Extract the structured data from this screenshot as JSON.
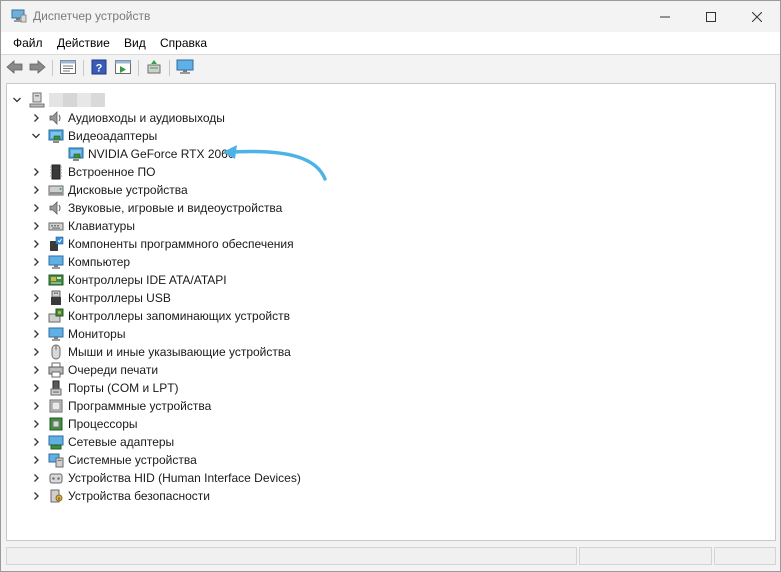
{
  "window": {
    "title": "Диспетчер устройств",
    "controls": [
      "minimize",
      "maximize",
      "close"
    ]
  },
  "menu": {
    "file": "Файл",
    "action": "Действие",
    "view": "Вид",
    "help": "Справка"
  },
  "toolbar": {
    "buttons": [
      "back-icon",
      "forward-icon",
      "properties-icon",
      "help-icon",
      "update-driver-icon",
      "scan-icon",
      "monitor-icon"
    ]
  },
  "tree": {
    "root_icon": "computer-icon",
    "categories": [
      {
        "label": "Аудиовходы и аудиовыходы",
        "icon": "speaker-icon",
        "expanded": false
      },
      {
        "label": "Видеоадаптеры",
        "icon": "display-adapter-icon",
        "expanded": true,
        "children": [
          {
            "label": "NVIDIA GeForce RTX 2060",
            "icon": "display-adapter-icon"
          }
        ]
      },
      {
        "label": "Встроенное ПО",
        "icon": "firmware-icon",
        "expanded": false
      },
      {
        "label": "Дисковые устройства",
        "icon": "disk-icon",
        "expanded": false
      },
      {
        "label": "Звуковые, игровые и видеоустройства",
        "icon": "speaker-icon",
        "expanded": false
      },
      {
        "label": "Клавиатуры",
        "icon": "keyboard-icon",
        "expanded": false
      },
      {
        "label": "Компоненты программного обеспечения",
        "icon": "software-component-icon",
        "expanded": false
      },
      {
        "label": "Компьютер",
        "icon": "monitor-icon",
        "expanded": false
      },
      {
        "label": "Контроллеры IDE ATA/ATAPI",
        "icon": "ide-controller-icon",
        "expanded": false
      },
      {
        "label": "Контроллеры USB",
        "icon": "usb-icon",
        "expanded": false
      },
      {
        "label": "Контроллеры запоминающих устройств",
        "icon": "storage-controller-icon",
        "expanded": false
      },
      {
        "label": "Мониторы",
        "icon": "monitor-icon",
        "expanded": false
      },
      {
        "label": "Мыши и иные указывающие устройства",
        "icon": "mouse-icon",
        "expanded": false
      },
      {
        "label": "Очереди печати",
        "icon": "printer-icon",
        "expanded": false
      },
      {
        "label": "Порты (COM и LPT)",
        "icon": "port-icon",
        "expanded": false
      },
      {
        "label": "Программные устройства",
        "icon": "software-device-icon",
        "expanded": false
      },
      {
        "label": "Процессоры",
        "icon": "processor-icon",
        "expanded": false
      },
      {
        "label": "Сетевые адаптеры",
        "icon": "network-adapter-icon",
        "expanded": false
      },
      {
        "label": "Системные устройства",
        "icon": "system-device-icon",
        "expanded": false
      },
      {
        "label": "Устройства HID (Human Interface Devices)",
        "icon": "hid-icon",
        "expanded": false
      },
      {
        "label": "Устройства безопасности",
        "icon": "security-device-icon",
        "expanded": false
      }
    ]
  },
  "annotation": {
    "arrow_color": "#4db3e6"
  }
}
